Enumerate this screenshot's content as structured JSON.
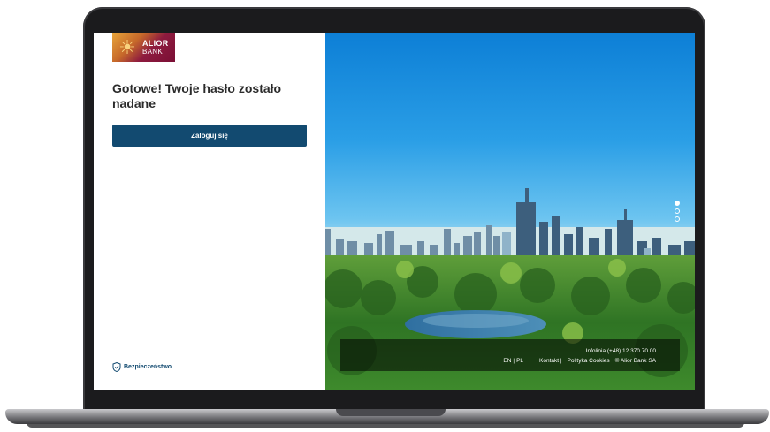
{
  "brand": {
    "logo_line1": "ALIOR",
    "logo_line2": "BANK",
    "colors": {
      "primary": "#124a70",
      "logo_accent": "#8e1b3f",
      "logo_gold": "#e8a53a"
    }
  },
  "main": {
    "title": "Gotowe! Twoje hasło zostało nadane",
    "login_button": "Zaloguj się",
    "security_link": "Bezpieczeństwo",
    "security_icon": "shield-icon"
  },
  "hero": {
    "carousel": {
      "slides": 3,
      "active": 1
    }
  },
  "footer": {
    "hotline": "Infolinia (+48) 12 370 70 00",
    "lang_en": "EN",
    "lang_sep": "|",
    "lang_pl": "PL",
    "contact": "Kontakt |",
    "cookies": "Polityka Cookies",
    "copyright": "© Alior Bank SA"
  }
}
